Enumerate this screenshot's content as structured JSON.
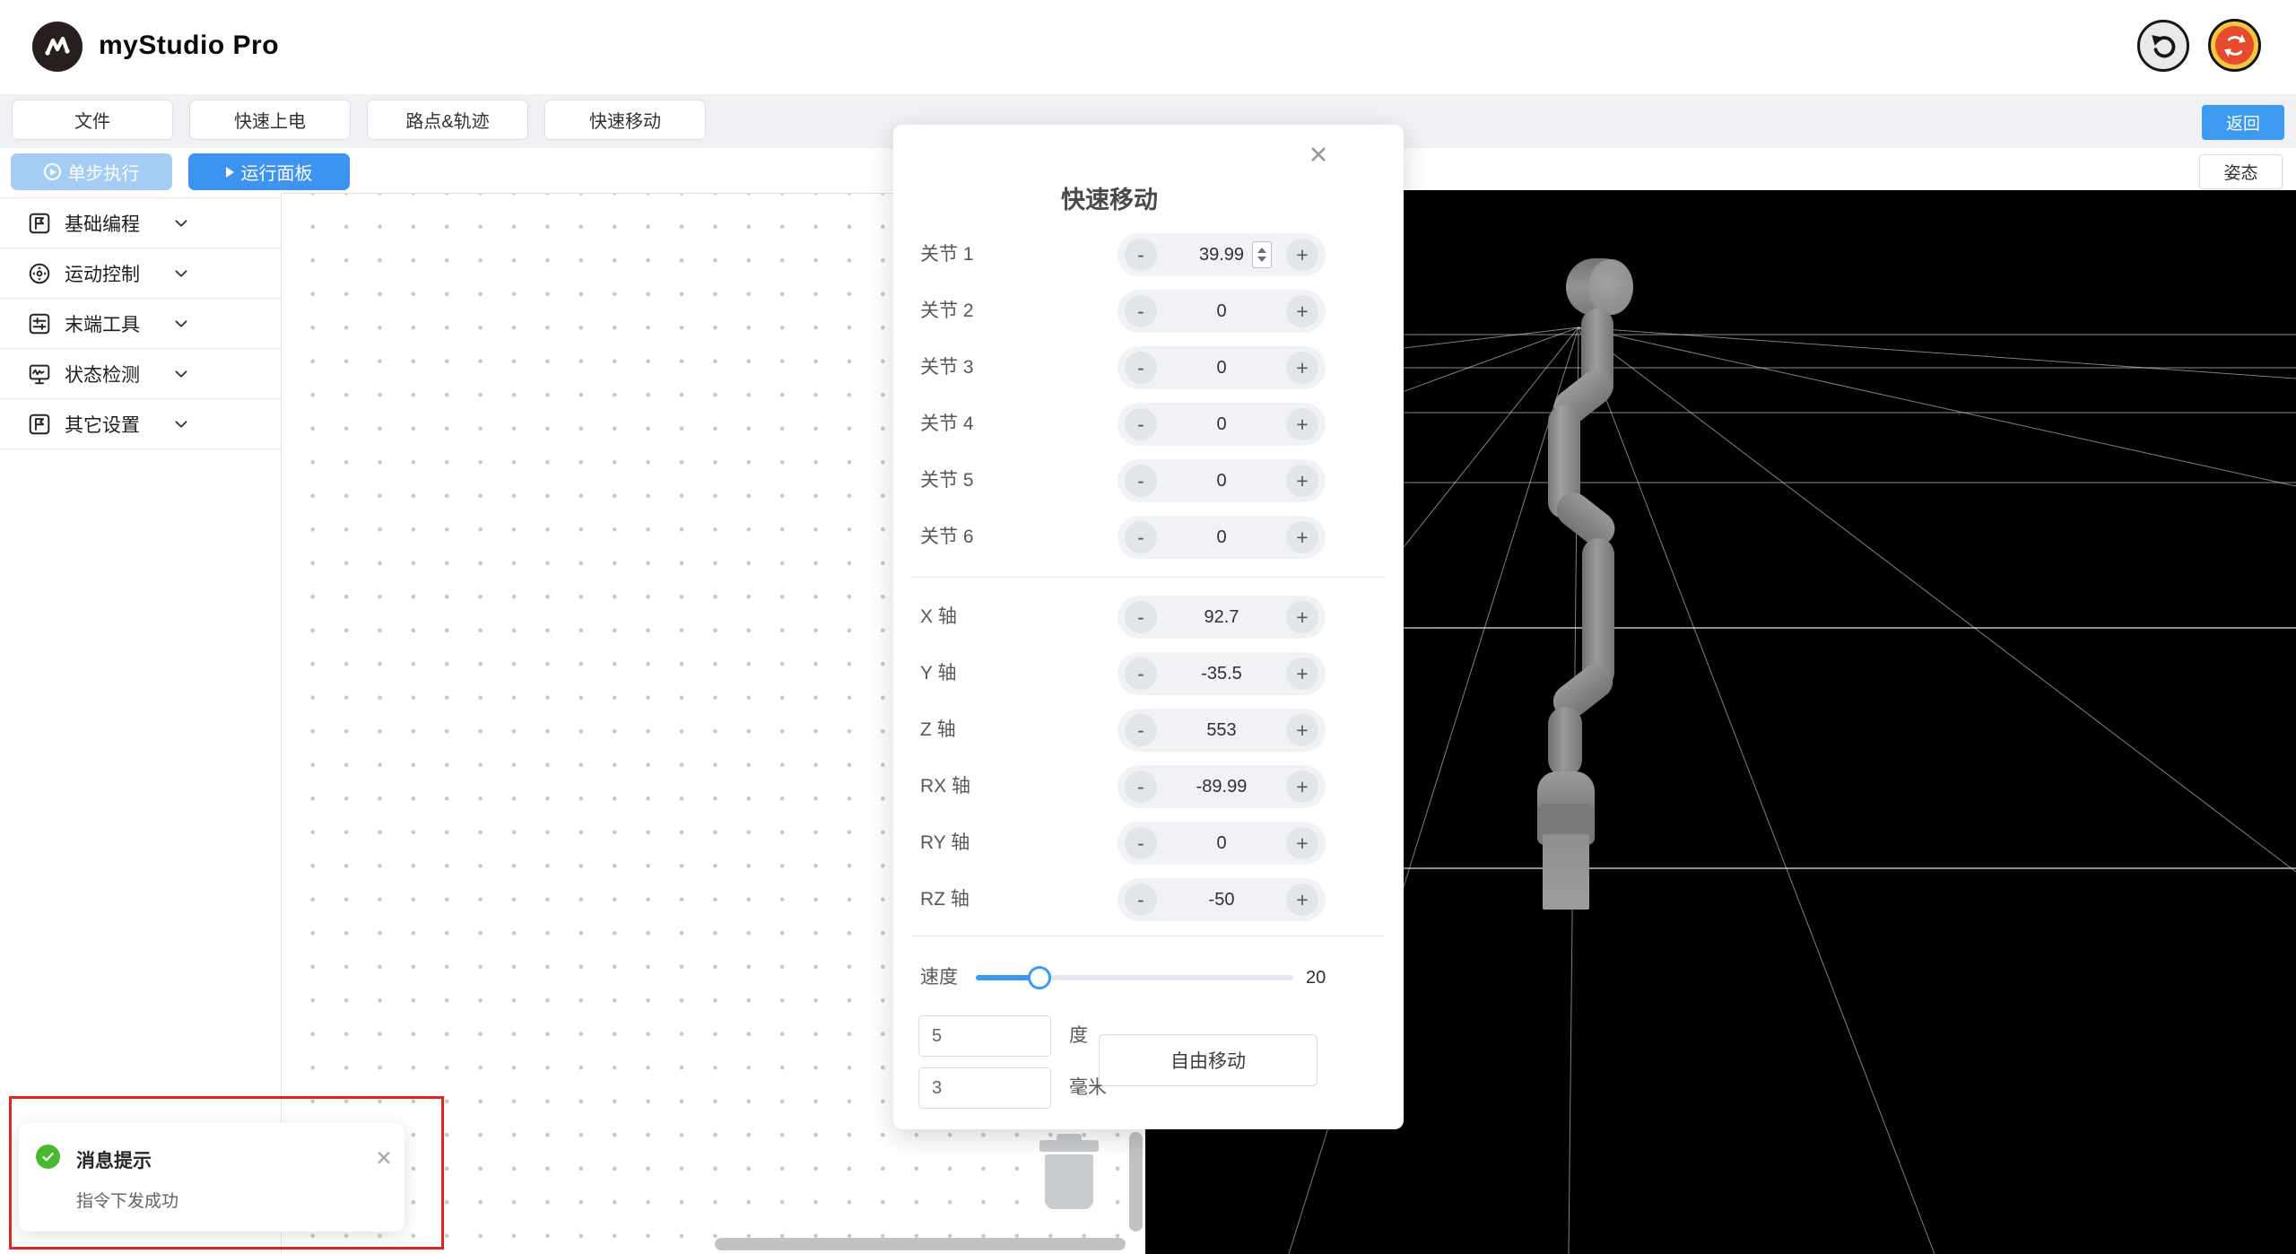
{
  "header": {
    "app_title": "myStudio Pro"
  },
  "toolbar": {
    "tabs": [
      "文件",
      "快速上电",
      "路点&轨迹",
      "快速移动"
    ],
    "return_label": "返回",
    "step_run_label": "单步执行",
    "run_panel_label": "运行面板",
    "pose_label": "姿态"
  },
  "sidebar": {
    "items": [
      {
        "label": "基础编程"
      },
      {
        "label": "运动控制"
      },
      {
        "label": "末端工具"
      },
      {
        "label": "状态检测"
      },
      {
        "label": "其它设置"
      }
    ]
  },
  "dialog": {
    "title": "快速移动",
    "minus_label": "-",
    "plus_label": "+",
    "joints": [
      {
        "label": "关节 1",
        "value": "39.99",
        "spinner": true
      },
      {
        "label": "关节 2",
        "value": "0"
      },
      {
        "label": "关节 3",
        "value": "0"
      },
      {
        "label": "关节 4",
        "value": "0"
      },
      {
        "label": "关节 5",
        "value": "0"
      },
      {
        "label": "关节 6",
        "value": "0"
      }
    ],
    "axes": [
      {
        "label": "X 轴",
        "value": "92.7"
      },
      {
        "label": "Y 轴",
        "value": "-35.5"
      },
      {
        "label": "Z 轴",
        "value": "553"
      },
      {
        "label": "RX 轴",
        "value": "-89.99"
      },
      {
        "label": "RY 轴",
        "value": "0"
      },
      {
        "label": "RZ 轴",
        "value": "-50"
      }
    ],
    "speed": {
      "label": "速度",
      "value": "20",
      "percent": 20
    },
    "angle_step": {
      "value": "5",
      "unit": "度"
    },
    "distance_step": {
      "value": "3",
      "unit": "毫米"
    },
    "free_move_label": "自由移动"
  },
  "notification": {
    "title": "消息提示",
    "message": "指令下发成功"
  },
  "colors": {
    "accent_blue": "#3d9af0",
    "disabled_blue": "#a5ccf4",
    "success_green": "#49b82e",
    "alert_red": "#e0251f",
    "estop_red": "#e84a2e",
    "estop_yellow": "#f4c73f"
  }
}
